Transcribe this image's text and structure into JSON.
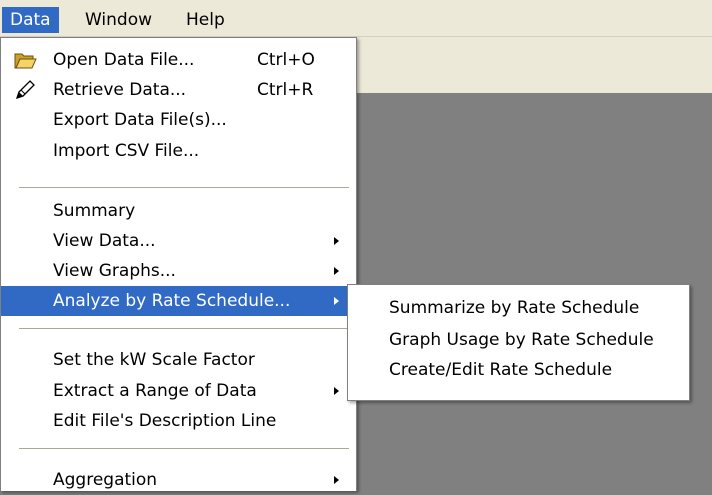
{
  "menubar": {
    "items": [
      "Data",
      "Window",
      "Help"
    ]
  },
  "data_menu": {
    "open_data_file": {
      "label": "Open Data File...",
      "shortcut": "Ctrl+O",
      "icon": "folder-open-icon"
    },
    "retrieve_data": {
      "label": "Retrieve Data...",
      "shortcut": "Ctrl+R",
      "icon": "pen-icon"
    },
    "export_data_files": {
      "label": "Export Data File(s)..."
    },
    "import_csv_file": {
      "label": "Import CSV File..."
    },
    "summary": {
      "label": "Summary"
    },
    "view_data": {
      "label": "View Data..."
    },
    "view_graphs": {
      "label": "View Graphs..."
    },
    "analyze_by_rate_schedule": {
      "label": "Analyze by Rate Schedule..."
    },
    "set_kw_scale_factor": {
      "label": "Set the kW Scale Factor"
    },
    "extract_range": {
      "label": "Extract a Range of Data"
    },
    "edit_description": {
      "label": "Edit File's Description Line"
    },
    "aggregation": {
      "label": "Aggregation"
    }
  },
  "submenu": {
    "summarize": "Summarize by Rate Schedule",
    "graph_usage": "Graph Usage by Rate Schedule",
    "create_edit": "Create/Edit Rate Schedule"
  },
  "colors": {
    "highlight": "#316ac5",
    "menubar_bg": "#ece9d8",
    "workspace_bg": "#808080"
  }
}
